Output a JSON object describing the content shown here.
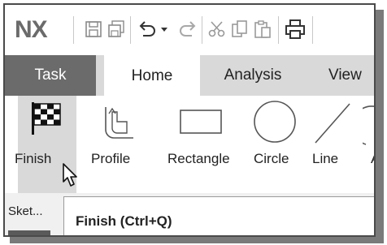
{
  "app": {
    "logo": "NX"
  },
  "quick_access": {
    "icons": [
      "save-icon",
      "save-all-icon",
      "undo-icon",
      "undo-dropdown-icon",
      "redo-icon",
      "cut-icon",
      "copy-icon",
      "paste-icon",
      "print-icon"
    ]
  },
  "tabs": [
    {
      "label": "Task",
      "state": "dark"
    },
    {
      "label": "Home",
      "state": "selected"
    },
    {
      "label": "Analysis",
      "state": "normal"
    },
    {
      "label": "View",
      "state": "normal"
    }
  ],
  "ribbon": {
    "finish": {
      "label": "Finish",
      "icon": "checkered-flag-icon"
    },
    "tools": [
      {
        "label": "Profile",
        "icon": "profile-icon"
      },
      {
        "label": "Rectangle",
        "icon": "rectangle-icon"
      },
      {
        "label": "Circle",
        "icon": "circle-icon"
      },
      {
        "label": "Line",
        "icon": "line-icon"
      },
      {
        "label": "A",
        "icon": "arc-icon"
      }
    ]
  },
  "lower": {
    "sketch_label": "Sket..."
  },
  "tooltip": {
    "text": "Finish (Ctrl+Q)"
  },
  "colors": {
    "dark_tab": "#6b6b6b",
    "tab_row": "#d9d9d9",
    "selected_tab": "#ffffff",
    "logo": "#6b6b6b"
  }
}
